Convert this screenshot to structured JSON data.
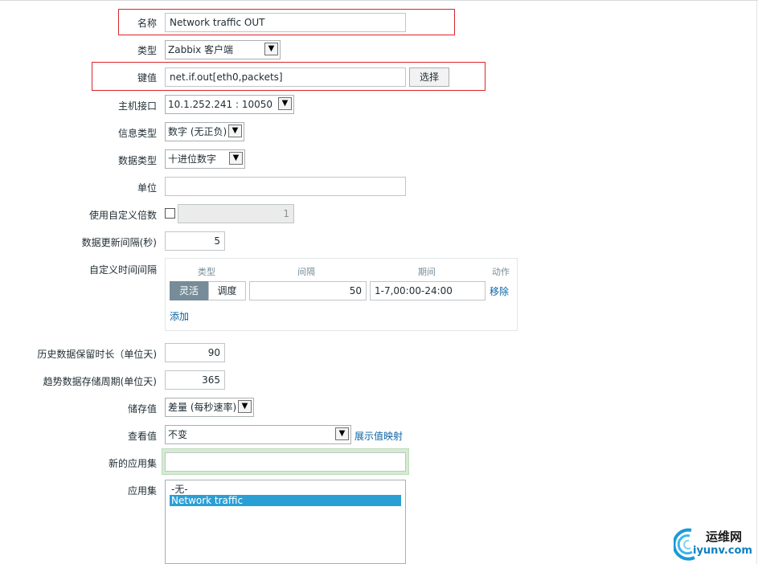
{
  "form": {
    "name": {
      "label": "名称",
      "value": "Network traffic OUT"
    },
    "type": {
      "label": "类型",
      "value": "Zabbix 客户端"
    },
    "key": {
      "label": "键值",
      "value": "net.if.out[eth0,packets]",
      "select_button": "选择"
    },
    "host_interface": {
      "label": "主机接口",
      "value": "10.1.252.241 : 10050"
    },
    "info_type": {
      "label": "信息类型",
      "value": "数字 (无正负)"
    },
    "data_type": {
      "label": "数据类型",
      "value": "十进位数字"
    },
    "units": {
      "label": "单位",
      "value": ""
    },
    "multiplier": {
      "label": "使用自定义倍数",
      "checked": false,
      "value": "1"
    },
    "update_interval": {
      "label": "数据更新间隔(秒)",
      "value": "5"
    },
    "custom_intervals": {
      "label": "自定义时间间隔",
      "headers": {
        "type": "类型",
        "interval": "间隔",
        "period": "期间",
        "action": "动作"
      },
      "rows": [
        {
          "type_on": "灵活",
          "type_off": "调度",
          "interval": "50",
          "period": "1-7,00:00-24:00",
          "action": "移除"
        }
      ],
      "add": "添加"
    },
    "history": {
      "label": "历史数据保留时长（单位天)",
      "value": "90"
    },
    "trends": {
      "label": "趋势数据存储周期(单位天)",
      "value": "365"
    },
    "store_value": {
      "label": "储存值",
      "value": "差量 (每秒速率)"
    },
    "show_value": {
      "label": "查看值",
      "value": "不变",
      "link": "展示值映射"
    },
    "new_application": {
      "label": "新的应用集",
      "value": ""
    },
    "applications": {
      "label": "应用集",
      "options": [
        "-无-",
        "Network traffic"
      ],
      "selected": "Network traffic"
    }
  },
  "watermark": {
    "line1": "运维网",
    "line2": "iyunv.com"
  },
  "colors": {
    "highlight_border": "#d9262b",
    "link": "#0b63a5",
    "selected_option": "#2a9fd6",
    "segment_active": "#768d99"
  }
}
